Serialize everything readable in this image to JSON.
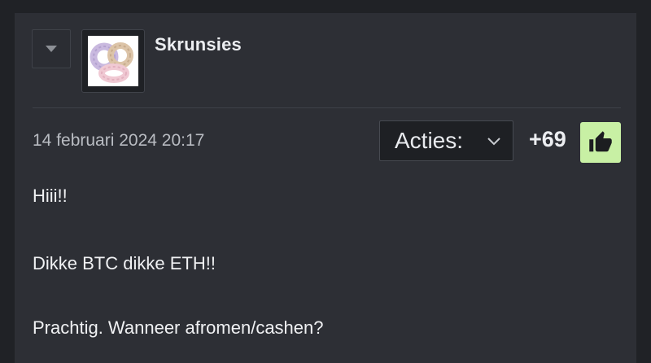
{
  "post": {
    "username": "Skrunsies",
    "date": "14 februari 2024 20:17",
    "actions_label": "Acties:",
    "score": "+69",
    "body": [
      "Hiii!!",
      "Dikke BTC dikke ETH!!",
      "Prachtig. Wanneer afromen/cashen?"
    ]
  },
  "icons": {
    "collapse": "triangle-down-icon",
    "actions_chevron": "chevron-down-icon",
    "like": "thumbs-up-icon",
    "avatar": "scrunchies-avatar-image"
  },
  "colors": {
    "page_bg": "#202226",
    "card_bg": "#2d2f35",
    "like_bg": "#c8f0a4",
    "text": "#f0f1f3",
    "muted_text": "#b9bcc2"
  }
}
